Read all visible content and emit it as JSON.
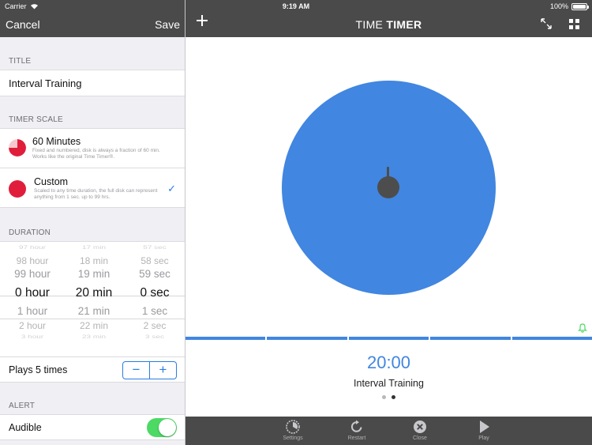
{
  "status_bar": {
    "carrier": "Carrier",
    "time": "9:19 AM",
    "battery": "100%"
  },
  "settings": {
    "cancel_label": "Cancel",
    "save_label": "Save",
    "title_section": "TITLE",
    "title_value": "Interval Training",
    "scale_section": "TIMER SCALE",
    "scale_options": [
      {
        "name": "60 Minutes",
        "description": "Fixed and numbered, disk is always a fraction of 60 min. Works like the original Time Timer®.",
        "icon": "pie-60-icon",
        "selected": false
      },
      {
        "name": "Custom",
        "description": "Scaled to any time duration, the full disk can represent anything from 1 sec. up to 99 hrs.",
        "icon": "full-disk-icon",
        "selected": true
      }
    ],
    "duration_section": "DURATION",
    "picker": {
      "hours": [
        "97 hour",
        "98 hour",
        "99 hour",
        "0 hour",
        "1 hour",
        "2 hour",
        "3 hour"
      ],
      "minutes": [
        "17 min",
        "18 min",
        "19 min",
        "20 min",
        "21 min",
        "22 min",
        "23 min"
      ],
      "seconds": [
        "57 sec",
        "58 sec",
        "59 sec",
        "0 sec",
        "1 sec",
        "2 sec",
        "3 sec"
      ]
    },
    "plays_label": "Plays 5 times",
    "stepper_minus": "−",
    "stepper_plus": "+",
    "alert_section": "ALERT",
    "audible_label": "Audible",
    "audible_on": true
  },
  "timer": {
    "app_title_light": "TIME ",
    "app_title_bold": "TIMER",
    "countdown": "20:00",
    "name": "Interval Training",
    "progress_segments": 5,
    "page_count": 2,
    "active_page": 1,
    "colors": {
      "disk": "#4186e0",
      "accent": "#2a7de1",
      "scale_dot": "#e01e3c",
      "toggle_on": "#4cd964",
      "bell": "#4cd964"
    }
  },
  "toolbar": {
    "settings_label": "Settings",
    "restart_label": "Restart",
    "close_label": "Close",
    "play_label": "Play"
  }
}
